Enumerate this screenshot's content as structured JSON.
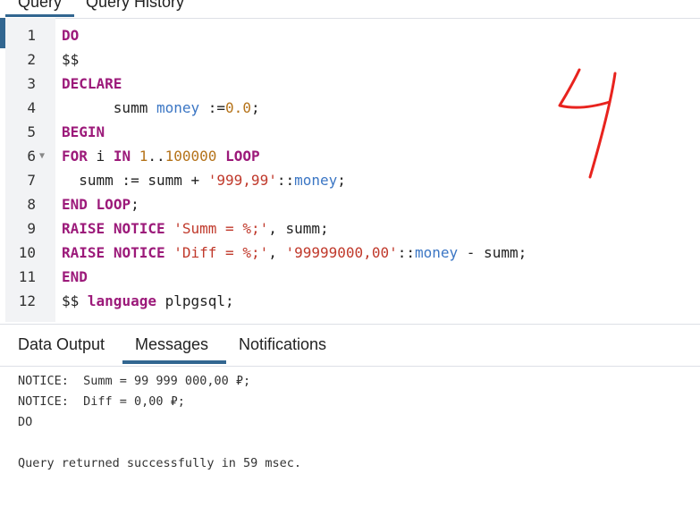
{
  "top_tabs": [
    {
      "label": "Query"
    },
    {
      "label": "Query History"
    }
  ],
  "editor": {
    "line_numbers": [
      "1",
      "2",
      "3",
      "4",
      "5",
      "6",
      "7",
      "8",
      "9",
      "10",
      "11",
      "12"
    ],
    "fold_marker_line": "6"
  },
  "annotation": {
    "handwritten_text": "4",
    "color": "#e8231e"
  },
  "results_tabs": [
    {
      "label": "Data Output"
    },
    {
      "label": "Messages"
    },
    {
      "label": "Notifications"
    }
  ],
  "messages": {
    "line1": "NOTICE:  Summ = 99 999 000,00 ₽;",
    "line2": "NOTICE:  Diff = 0,00 ₽;",
    "line3": "DO",
    "line4": "",
    "line5": "Query returned successfully in 59 msec."
  },
  "colors": {
    "accent": "#326690",
    "keyword": "#9c1a7a",
    "type": "#3b76c4",
    "number": "#b5731a",
    "string": "#c0392b"
  }
}
